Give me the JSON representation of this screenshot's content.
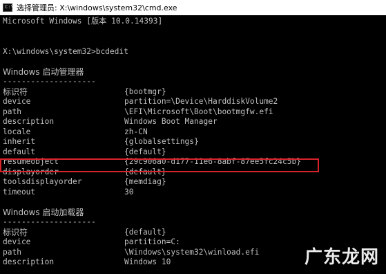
{
  "window": {
    "title": "选择管理员: X:\\windows\\system32\\cmd.exe",
    "icon": "cmd-icon",
    "icon_glyph": "C:\\"
  },
  "console": {
    "version_line": "Microsoft Windows [版本 10.0.14393]",
    "prompt_line": "X:\\windows\\system32>bcdedit",
    "boot_manager": {
      "heading": "Windows 启动管理器",
      "separator": "--------------------",
      "entries": [
        {
          "key": "标识符",
          "value": "{bootmgr}"
        },
        {
          "key": "device",
          "value": "partition=\\Device\\HarddiskVolume2"
        },
        {
          "key": "path",
          "value": "\\EFI\\Microsoft\\Boot\\bootmgfw.efi"
        },
        {
          "key": "description",
          "value": "Windows Boot Manager"
        },
        {
          "key": "locale",
          "value": "zh-CN"
        },
        {
          "key": "inherit",
          "value": "{globalsettings}"
        },
        {
          "key": "default",
          "value": "{default}"
        },
        {
          "key": "resumeobject",
          "value": "{29c906a0-d177-11e6-8abf-87ee5fc24c5b}"
        },
        {
          "key": "displayorder",
          "value": "{default}"
        },
        {
          "key": "toolsdisplayorder",
          "value": "{memdiag}"
        },
        {
          "key": "timeout",
          "value": "30"
        }
      ]
    },
    "boot_loader": {
      "heading": "Windows 启动加载器",
      "separator": "--------------------",
      "entries": [
        {
          "key": "标识符",
          "value": "{default}"
        },
        {
          "key": "device",
          "value": "partition=C:"
        },
        {
          "key": "path",
          "value": "\\Windows\\system32\\winload.efi"
        },
        {
          "key": "description",
          "value": "Windows 10"
        }
      ]
    }
  },
  "watermark": "广东龙网",
  "colors": {
    "console_bg": "#000000",
    "console_text": "#c0c0c0",
    "highlight_border": "#d8232a",
    "titlebar_bg": "#ffffff"
  }
}
